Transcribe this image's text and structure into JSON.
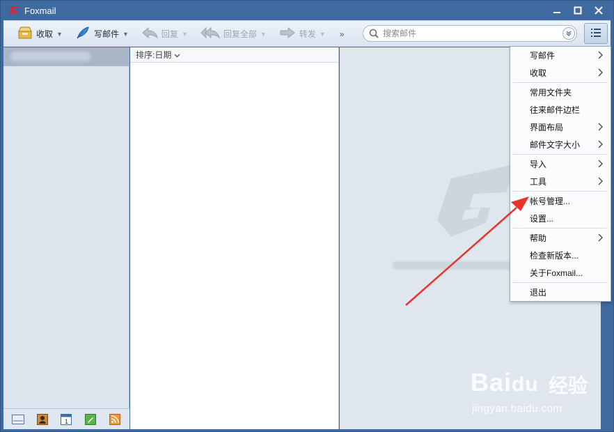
{
  "window": {
    "title": "Foxmail"
  },
  "toolbar": {
    "receive_label": "收取",
    "compose_label": "写邮件",
    "reply_label": "回复",
    "reply_all_label": "回复全部",
    "forward_label": "转发",
    "more_label": "»"
  },
  "search": {
    "placeholder": "搜索邮件"
  },
  "list": {
    "sort_label": "排序:日期"
  },
  "menu": {
    "compose": "写邮件",
    "receive": "收取",
    "favorites": "常用文件夹",
    "correspondence_sidebar": "往来邮件边栏",
    "layout": "界面布局",
    "font_size": "邮件文字大小",
    "import": "导入",
    "tools": "工具",
    "account_manage": "帐号管理...",
    "settings": "设置...",
    "help": "帮助",
    "check_update": "检查新版本...",
    "about": "关于Foxmail...",
    "exit": "退出"
  },
  "watermark": {
    "brand": "Bai",
    "brand2": "经验",
    "url": "jingyan.baidu.com"
  },
  "colors": {
    "frame": "#3e6aa0",
    "accent_arrow": "#e8352b",
    "app_logo": "#d8272d"
  },
  "icons": [
    "app-logo-icon",
    "minimize-icon",
    "maximize-icon",
    "close-icon",
    "inbox-tray-icon",
    "feather-pen-icon",
    "reply-arrow-icon",
    "reply-all-arrow-icon",
    "forward-arrow-icon",
    "search-icon",
    "chevron-down-icon",
    "list-menu-icon",
    "mail-icon",
    "contacts-icon",
    "calendar-icon",
    "notes-icon",
    "rss-icon"
  ]
}
